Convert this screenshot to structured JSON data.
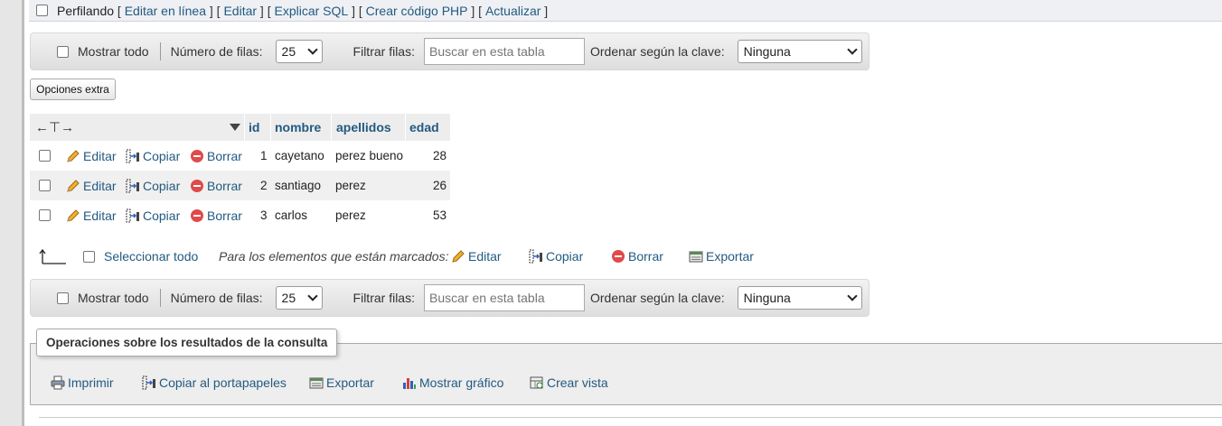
{
  "profiling": {
    "label": "Perfilando",
    "links": [
      "Editar en línea",
      "Editar",
      "Explicar SQL",
      "Crear código PHP",
      "Actualizar"
    ]
  },
  "nav": {
    "show_all": "Mostrar todo",
    "rows_label": "Número de filas:",
    "rows_value": "25",
    "filter_label": "Filtrar filas:",
    "filter_placeholder": "Buscar en esta tabla",
    "sort_label": "Ordenar según la clave:",
    "sort_value": "Ninguna"
  },
  "extra_options": "Opciones extra",
  "table": {
    "columns": [
      "id",
      "nombre",
      "apellidos",
      "edad"
    ],
    "actions": {
      "edit": "Editar",
      "copy": "Copiar",
      "delete": "Borrar"
    },
    "rows": [
      {
        "id": "1",
        "nombre": "cayetano",
        "apellidos": "perez bueno",
        "edad": "28"
      },
      {
        "id": "2",
        "nombre": "santiago",
        "apellidos": "perez",
        "edad": "26"
      },
      {
        "id": "3",
        "nombre": "carlos",
        "apellidos": "perez",
        "edad": "53"
      }
    ]
  },
  "bulk": {
    "select_all": "Seleccionar todo",
    "with_selected": "Para los elementos que están marcados:",
    "edit": "Editar",
    "copy": "Copiar",
    "delete": "Borrar",
    "export": "Exportar"
  },
  "operations": {
    "legend": "Operaciones sobre los resultados de la consulta",
    "print": "Imprimir",
    "copy_clipboard": "Copiar al portapapeles",
    "export": "Exportar",
    "chart": "Mostrar gráfico",
    "create_view": "Crear vista"
  },
  "colors": {
    "link": "#235a81",
    "delete_icon": "#e04a4a",
    "edit_icon": "#e0a020"
  }
}
